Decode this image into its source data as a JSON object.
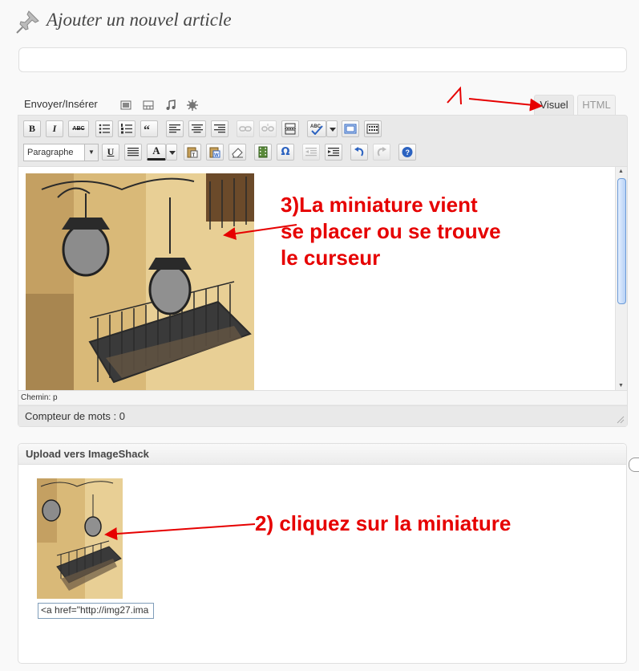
{
  "header": {
    "title": "Ajouter un nouvel article",
    "icon": "pushpin-icon"
  },
  "title_field": {
    "value": "",
    "placeholder": ""
  },
  "media": {
    "label": "Envoyer/Insérer",
    "icons": [
      "image-icon",
      "video-icon",
      "audio-icon",
      "media-icon"
    ]
  },
  "tabs": {
    "visual": "Visuel",
    "html": "HTML",
    "active": "Visuel"
  },
  "toolbar": {
    "row1": [
      "bold-icon",
      "italic-icon",
      "strikethrough-icon",
      "bullet-list-icon",
      "numbered-list-icon",
      "blockquote-icon",
      "align-left-icon",
      "align-center-icon",
      "align-right-icon",
      "link-icon",
      "unlink-icon",
      "more-tag-icon",
      "spellcheck-icon",
      "fullscreen-icon",
      "kitchen-sink-icon"
    ],
    "row2": [
      "underline-icon",
      "justify-icon",
      "text-color-icon",
      "paste-text-icon",
      "paste-word-icon",
      "remove-format-icon",
      "embed-media-icon",
      "special-char-icon",
      "outdent-icon",
      "indent-icon",
      "undo-icon",
      "redo-icon",
      "help-icon"
    ],
    "bold_label": "B",
    "italic_label": "I",
    "strike_label": "ABC",
    "underline_label": "U",
    "color_label": "A",
    "omega_label": "Ω",
    "format_select": "Paragraphe"
  },
  "editor": {
    "path": "Chemin: p",
    "word_count": "Compteur de mots : 0"
  },
  "upload": {
    "title": "Upload vers ImageShack",
    "code_value": "<a href=\"http://img27.ima"
  },
  "annotations": {
    "step1": "1",
    "step3_line1": "3)La miniature vient",
    "step3_line2": "se placer ou se trouve",
    "step3_line3": "le curseur",
    "step2": "2) cliquez sur la miniature"
  },
  "colors": {
    "annotation": "#e60000",
    "link_blue": "#21759b",
    "border": "#dfdfdf"
  }
}
